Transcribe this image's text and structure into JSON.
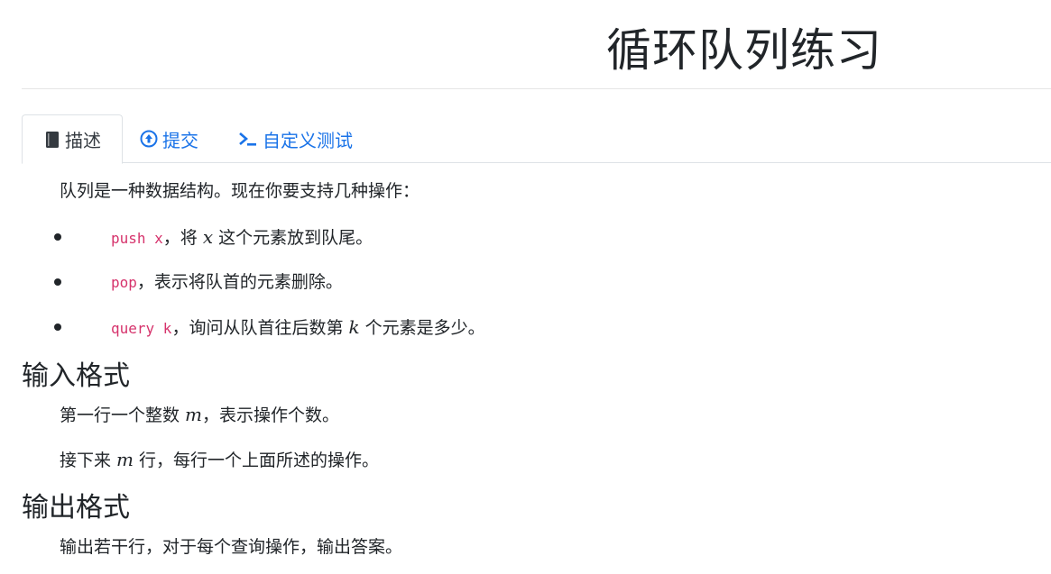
{
  "title": "循环队列练习",
  "tabs": [
    {
      "label": "描述",
      "icon": "book-icon",
      "active": true
    },
    {
      "label": "提交",
      "icon": "upload-circle-icon",
      "active": false
    },
    {
      "label": "自定义测试",
      "icon": "terminal-icon",
      "active": false
    }
  ],
  "description": {
    "intro": "队列是一种数据结构。现在你要支持几种操作：",
    "operations": [
      {
        "code": "push x",
        "text_before_var": "，将 ",
        "var": "x",
        "text_after_var": " 这个元素放到队尾。"
      },
      {
        "code": "pop",
        "text": "，表示将队首的元素删除。"
      },
      {
        "code": "query k",
        "text_before_var": "，询问从队首往后数第 ",
        "var": "k",
        "text_after_var": " 个元素是多少。"
      }
    ]
  },
  "input_format": {
    "heading": "输入格式",
    "line1_before": "第一行一个整数 ",
    "line1_var": "m",
    "line1_after": "，表示操作个数。",
    "line2_before": "接下来 ",
    "line2_var": "m",
    "line2_after": " 行，每行一个上面所述的操作。"
  },
  "output_format": {
    "heading": "输出格式",
    "line1": "输出若干行，对于每个查询操作，输出答案。"
  },
  "colors": {
    "link": "#1a73e8",
    "code": "#d6336c",
    "text": "#212529"
  }
}
